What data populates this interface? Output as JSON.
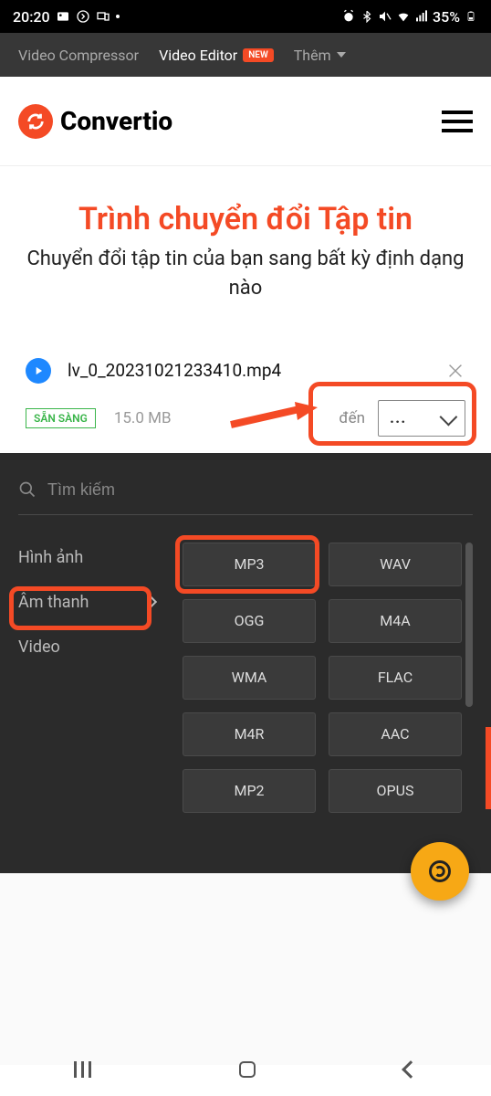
{
  "status_bar": {
    "time": "20:20",
    "battery_text": "35%"
  },
  "top_nav": {
    "items": [
      {
        "label": "Video Compressor"
      },
      {
        "label": "Video Editor",
        "badge": "NEW"
      },
      {
        "label": "Thêm"
      }
    ]
  },
  "brand": {
    "name": "Convertio"
  },
  "hero": {
    "title": "Trình chuyển đổi Tập tin",
    "subtitle": "Chuyển đổi tập tin của bạn sang bất kỳ định dạng nào"
  },
  "file": {
    "name": "lv_0_20231021233410.mp4",
    "ready_label": "SẴN SÀNG",
    "size": "15.0 MB",
    "to_label": "đến",
    "format_placeholder": "..."
  },
  "format_panel": {
    "search_placeholder": "Tìm kiếm",
    "categories": [
      {
        "label": "Hình ảnh"
      },
      {
        "label": "Âm thanh",
        "active": true
      },
      {
        "label": "Video"
      }
    ],
    "formats": [
      "MP3",
      "WAV",
      "OGG",
      "M4A",
      "WMA",
      "FLAC",
      "M4R",
      "AAC",
      "MP2",
      "OPUS"
    ]
  }
}
